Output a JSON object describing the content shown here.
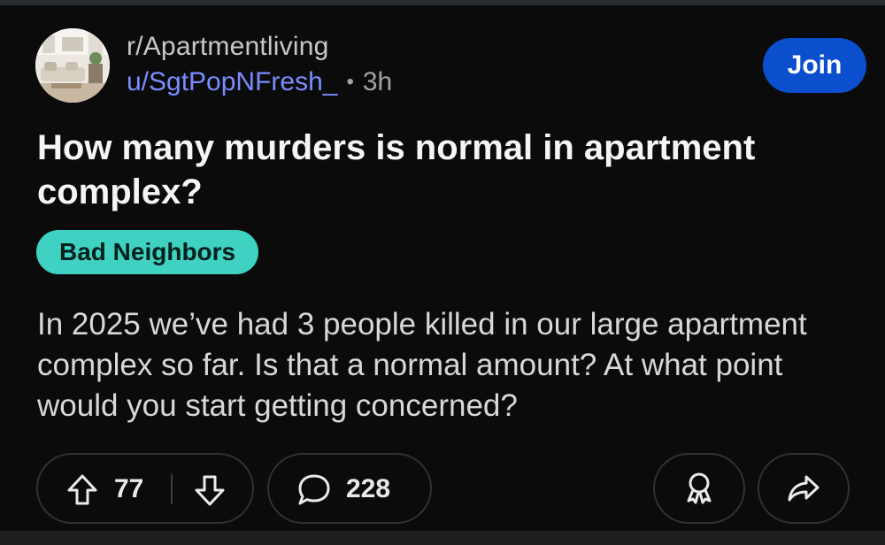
{
  "post": {
    "subreddit": "r/Apartmentliving",
    "username": "u/SgtPopNFresh_",
    "separator": "•",
    "time_ago": "3h",
    "join_label": "Join",
    "title": "How many murders is normal in apartment complex?",
    "flair": "Bad Neighbors",
    "body": "In 2025 we’ve had 3 people killed in our large apartment complex so far. Is that a normal amount? At what point would you start getting concerned?"
  },
  "actions": {
    "upvotes": "77",
    "comments": "228"
  },
  "icons": {
    "upvote": "arrow-up-icon",
    "downvote": "arrow-down-icon",
    "comment": "speech-bubble-icon",
    "award": "award-ribbon-icon",
    "share": "share-arrow-icon"
  },
  "colors": {
    "background": "#0b0b0c",
    "join_button": "#0b4fce",
    "username": "#7a8cff",
    "flair": "#3fd1c1"
  }
}
